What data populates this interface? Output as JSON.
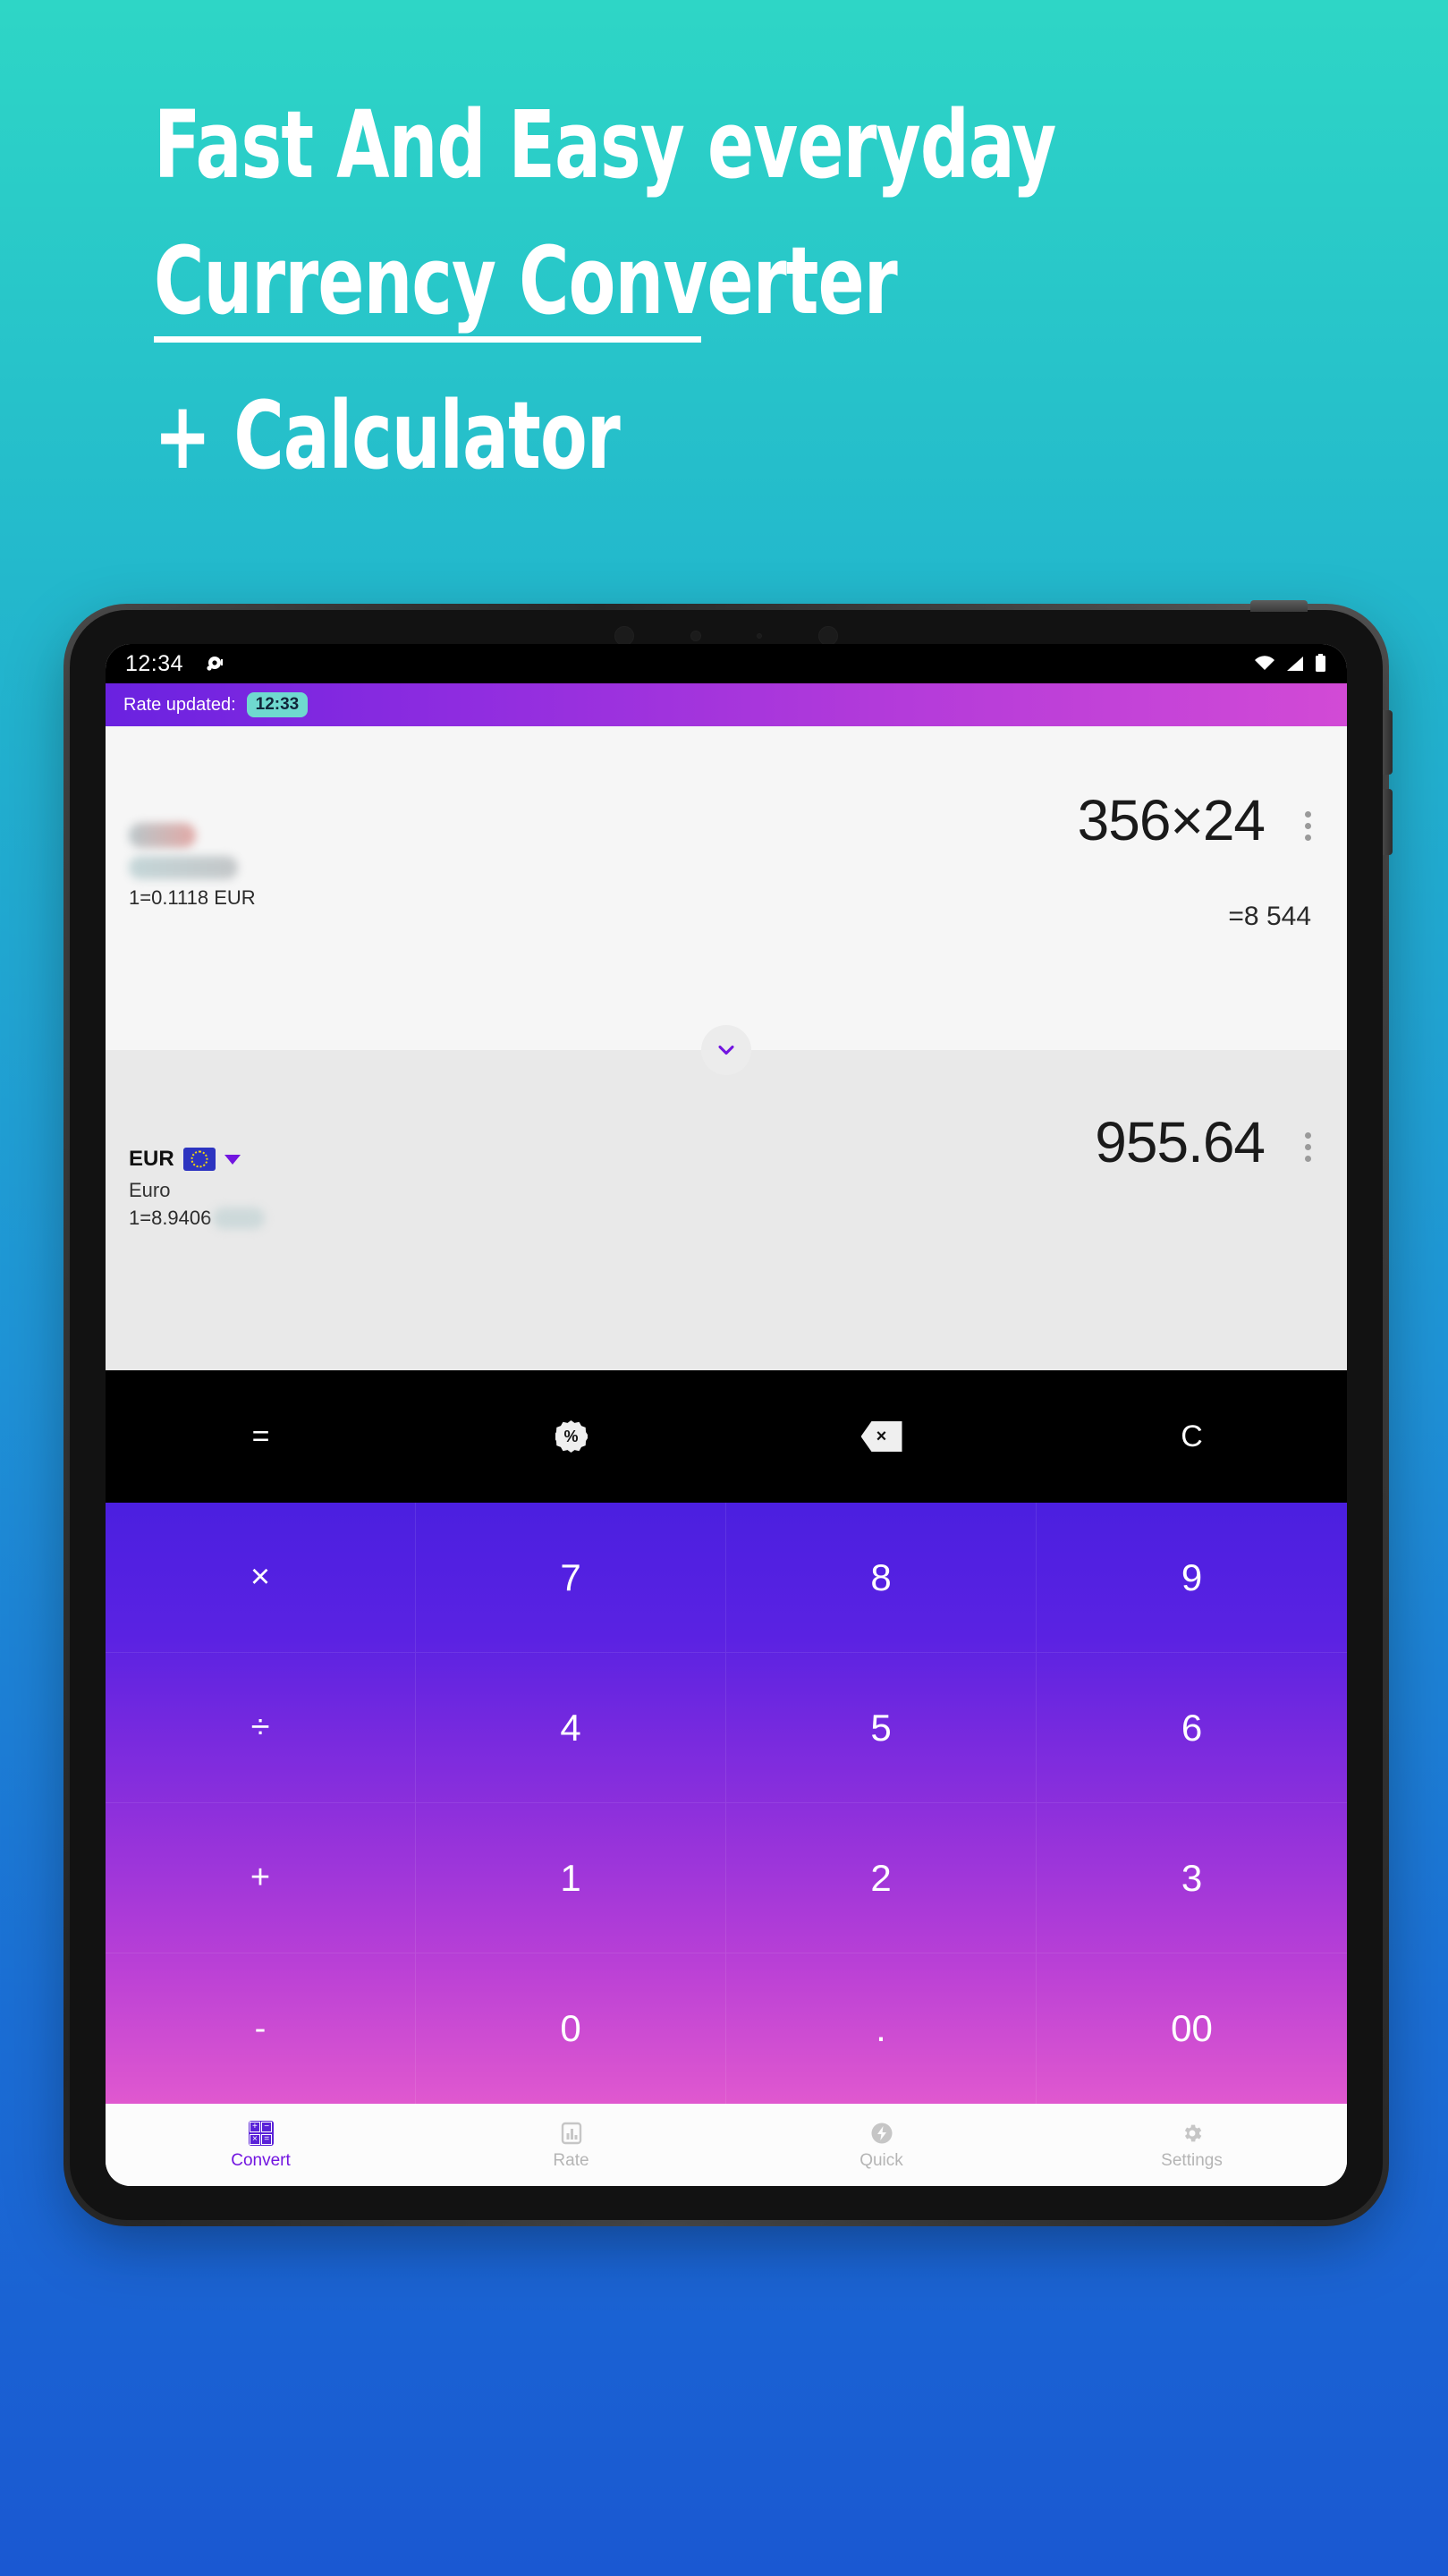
{
  "promo": {
    "line1": "Fast And Easy everyday",
    "line2": "Currency Converter",
    "line3": "+ Calculator"
  },
  "colors": {
    "bg_top": "#2ed6c6",
    "bg_bottom": "#1a58d2",
    "accent_purple": "#7215e0",
    "keypad_top": "#4b1fe0",
    "keypad_bottom": "#e058cf",
    "badge_teal": "#6fd9cf"
  },
  "status_bar": {
    "time": "12:34",
    "notification_icon": "notification-dot-icon",
    "wifi_icon": "wifi-icon",
    "signal_icon": "signal-icon",
    "battery_icon": "battery-icon"
  },
  "rate_bar": {
    "label": "Rate updated:",
    "time_badge": "12:33"
  },
  "top_panel": {
    "currency_code_hidden": true,
    "rate_line": "1=0.1118 EUR",
    "expression": "356×24",
    "result": "=8 544",
    "menu_icon": "kebab-menu-icon"
  },
  "swap": {
    "icon": "chevron-down-icon"
  },
  "bottom_panel": {
    "currency_code": "EUR",
    "flag_icon": "eu-flag-icon",
    "dropdown_icon": "caret-down-icon",
    "currency_name": "Euro",
    "rate_line": "1=8.9406",
    "amount": "955.64",
    "menu_icon": "kebab-menu-icon"
  },
  "function_bar": {
    "keys": [
      {
        "label": "=",
        "name": "equals-key",
        "type": "text"
      },
      {
        "label": "%",
        "name": "percent-key",
        "type": "badge"
      },
      {
        "label": "×",
        "name": "backspace-key",
        "type": "backspace"
      },
      {
        "label": "C",
        "name": "clear-key",
        "type": "text"
      }
    ]
  },
  "keypad": {
    "keys": [
      {
        "label": "×",
        "name": "multiply-key"
      },
      {
        "label": "7",
        "name": "digit-7-key"
      },
      {
        "label": "8",
        "name": "digit-8-key"
      },
      {
        "label": "9",
        "name": "digit-9-key"
      },
      {
        "label": "÷",
        "name": "divide-key"
      },
      {
        "label": "4",
        "name": "digit-4-key"
      },
      {
        "label": "5",
        "name": "digit-5-key"
      },
      {
        "label": "6",
        "name": "digit-6-key"
      },
      {
        "label": "+",
        "name": "plus-key"
      },
      {
        "label": "1",
        "name": "digit-1-key"
      },
      {
        "label": "2",
        "name": "digit-2-key"
      },
      {
        "label": "3",
        "name": "digit-3-key"
      },
      {
        "label": "-",
        "name": "minus-key"
      },
      {
        "label": "0",
        "name": "digit-0-key"
      },
      {
        "label": ".",
        "name": "decimal-key"
      },
      {
        "label": "00",
        "name": "double-zero-key"
      }
    ]
  },
  "bottom_nav": {
    "items": [
      {
        "label": "Convert",
        "icon": "calculator-icon",
        "active": true
      },
      {
        "label": "Rate",
        "icon": "bar-chart-icon",
        "active": false
      },
      {
        "label": "Quick",
        "icon": "flash-icon",
        "active": false
      },
      {
        "label": "Settings",
        "icon": "gear-icon",
        "active": false
      }
    ]
  }
}
